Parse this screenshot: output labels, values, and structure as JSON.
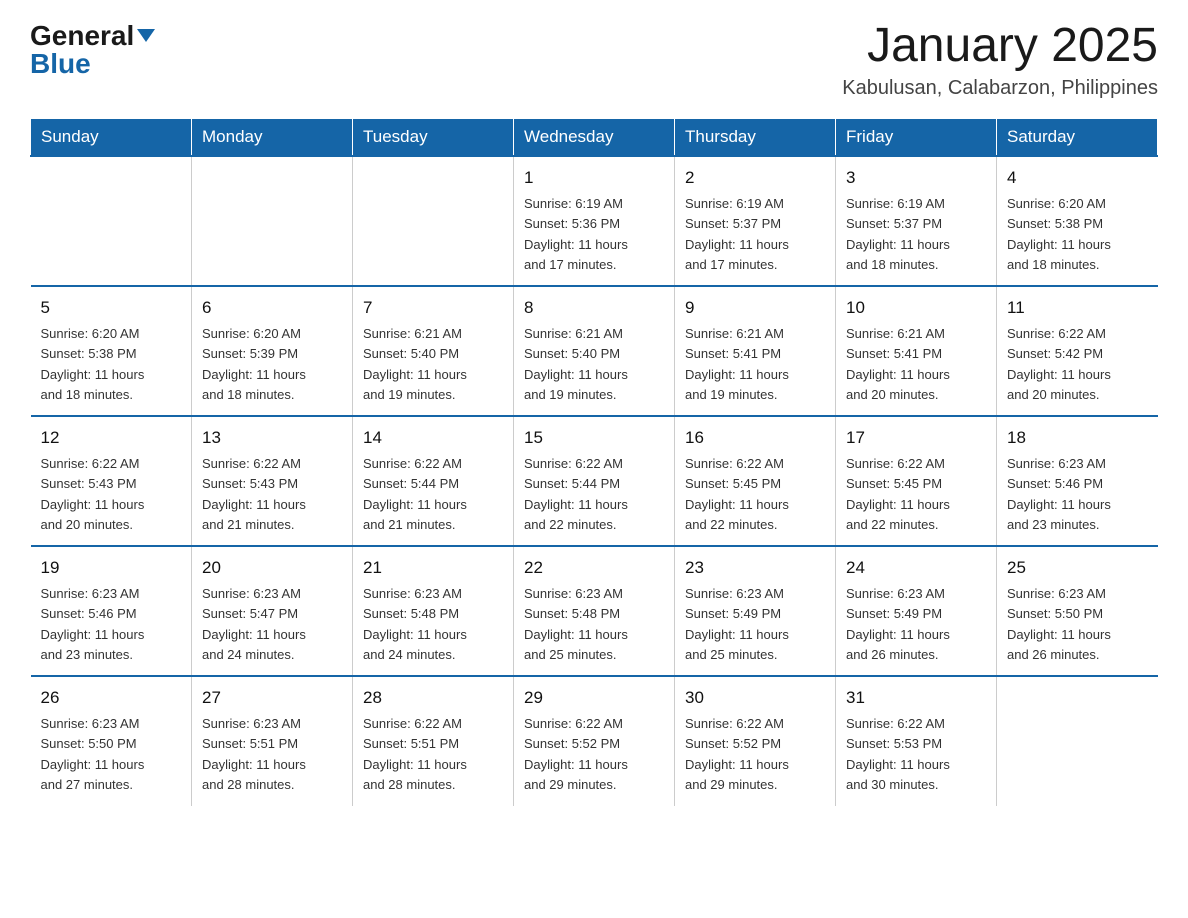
{
  "header": {
    "logo_general": "General",
    "logo_blue": "Blue",
    "month_year": "January 2025",
    "location": "Kabulusan, Calabarzon, Philippines"
  },
  "days_of_week": [
    "Sunday",
    "Monday",
    "Tuesday",
    "Wednesday",
    "Thursday",
    "Friday",
    "Saturday"
  ],
  "weeks": [
    [
      {
        "day": "",
        "info": ""
      },
      {
        "day": "",
        "info": ""
      },
      {
        "day": "",
        "info": ""
      },
      {
        "day": "1",
        "info": "Sunrise: 6:19 AM\nSunset: 5:36 PM\nDaylight: 11 hours\nand 17 minutes."
      },
      {
        "day": "2",
        "info": "Sunrise: 6:19 AM\nSunset: 5:37 PM\nDaylight: 11 hours\nand 17 minutes."
      },
      {
        "day": "3",
        "info": "Sunrise: 6:19 AM\nSunset: 5:37 PM\nDaylight: 11 hours\nand 18 minutes."
      },
      {
        "day": "4",
        "info": "Sunrise: 6:20 AM\nSunset: 5:38 PM\nDaylight: 11 hours\nand 18 minutes."
      }
    ],
    [
      {
        "day": "5",
        "info": "Sunrise: 6:20 AM\nSunset: 5:38 PM\nDaylight: 11 hours\nand 18 minutes."
      },
      {
        "day": "6",
        "info": "Sunrise: 6:20 AM\nSunset: 5:39 PM\nDaylight: 11 hours\nand 18 minutes."
      },
      {
        "day": "7",
        "info": "Sunrise: 6:21 AM\nSunset: 5:40 PM\nDaylight: 11 hours\nand 19 minutes."
      },
      {
        "day": "8",
        "info": "Sunrise: 6:21 AM\nSunset: 5:40 PM\nDaylight: 11 hours\nand 19 minutes."
      },
      {
        "day": "9",
        "info": "Sunrise: 6:21 AM\nSunset: 5:41 PM\nDaylight: 11 hours\nand 19 minutes."
      },
      {
        "day": "10",
        "info": "Sunrise: 6:21 AM\nSunset: 5:41 PM\nDaylight: 11 hours\nand 20 minutes."
      },
      {
        "day": "11",
        "info": "Sunrise: 6:22 AM\nSunset: 5:42 PM\nDaylight: 11 hours\nand 20 minutes."
      }
    ],
    [
      {
        "day": "12",
        "info": "Sunrise: 6:22 AM\nSunset: 5:43 PM\nDaylight: 11 hours\nand 20 minutes."
      },
      {
        "day": "13",
        "info": "Sunrise: 6:22 AM\nSunset: 5:43 PM\nDaylight: 11 hours\nand 21 minutes."
      },
      {
        "day": "14",
        "info": "Sunrise: 6:22 AM\nSunset: 5:44 PM\nDaylight: 11 hours\nand 21 minutes."
      },
      {
        "day": "15",
        "info": "Sunrise: 6:22 AM\nSunset: 5:44 PM\nDaylight: 11 hours\nand 22 minutes."
      },
      {
        "day": "16",
        "info": "Sunrise: 6:22 AM\nSunset: 5:45 PM\nDaylight: 11 hours\nand 22 minutes."
      },
      {
        "day": "17",
        "info": "Sunrise: 6:22 AM\nSunset: 5:45 PM\nDaylight: 11 hours\nand 22 minutes."
      },
      {
        "day": "18",
        "info": "Sunrise: 6:23 AM\nSunset: 5:46 PM\nDaylight: 11 hours\nand 23 minutes."
      }
    ],
    [
      {
        "day": "19",
        "info": "Sunrise: 6:23 AM\nSunset: 5:46 PM\nDaylight: 11 hours\nand 23 minutes."
      },
      {
        "day": "20",
        "info": "Sunrise: 6:23 AM\nSunset: 5:47 PM\nDaylight: 11 hours\nand 24 minutes."
      },
      {
        "day": "21",
        "info": "Sunrise: 6:23 AM\nSunset: 5:48 PM\nDaylight: 11 hours\nand 24 minutes."
      },
      {
        "day": "22",
        "info": "Sunrise: 6:23 AM\nSunset: 5:48 PM\nDaylight: 11 hours\nand 25 minutes."
      },
      {
        "day": "23",
        "info": "Sunrise: 6:23 AM\nSunset: 5:49 PM\nDaylight: 11 hours\nand 25 minutes."
      },
      {
        "day": "24",
        "info": "Sunrise: 6:23 AM\nSunset: 5:49 PM\nDaylight: 11 hours\nand 26 minutes."
      },
      {
        "day": "25",
        "info": "Sunrise: 6:23 AM\nSunset: 5:50 PM\nDaylight: 11 hours\nand 26 minutes."
      }
    ],
    [
      {
        "day": "26",
        "info": "Sunrise: 6:23 AM\nSunset: 5:50 PM\nDaylight: 11 hours\nand 27 minutes."
      },
      {
        "day": "27",
        "info": "Sunrise: 6:23 AM\nSunset: 5:51 PM\nDaylight: 11 hours\nand 28 minutes."
      },
      {
        "day": "28",
        "info": "Sunrise: 6:22 AM\nSunset: 5:51 PM\nDaylight: 11 hours\nand 28 minutes."
      },
      {
        "day": "29",
        "info": "Sunrise: 6:22 AM\nSunset: 5:52 PM\nDaylight: 11 hours\nand 29 minutes."
      },
      {
        "day": "30",
        "info": "Sunrise: 6:22 AM\nSunset: 5:52 PM\nDaylight: 11 hours\nand 29 minutes."
      },
      {
        "day": "31",
        "info": "Sunrise: 6:22 AM\nSunset: 5:53 PM\nDaylight: 11 hours\nand 30 minutes."
      },
      {
        "day": "",
        "info": ""
      }
    ]
  ]
}
